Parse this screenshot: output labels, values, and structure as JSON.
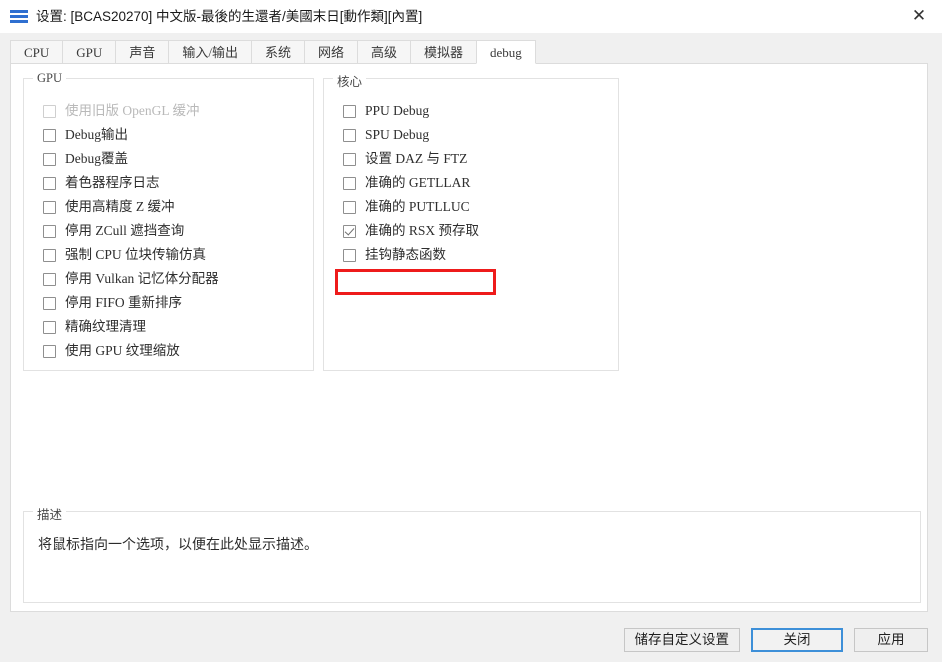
{
  "window": {
    "title": "设置: [BCAS20270] 中文版-最後的生還者/美國末日[動作類][內置]",
    "icon": "settings-lines-icon",
    "close_label": "✕"
  },
  "tabs": [
    {
      "label": "CPU",
      "active": false
    },
    {
      "label": "GPU",
      "active": false
    },
    {
      "label": "声音",
      "active": false
    },
    {
      "label": "输入/输出",
      "active": false
    },
    {
      "label": "系统",
      "active": false
    },
    {
      "label": "网络",
      "active": false
    },
    {
      "label": "高级",
      "active": false
    },
    {
      "label": "模拟器",
      "active": false
    },
    {
      "label": "debug",
      "active": true
    }
  ],
  "gpu_group": {
    "legend": "GPU",
    "items": [
      {
        "label": "使用旧版 OpenGL 缓冲",
        "checked": false,
        "disabled": true
      },
      {
        "label": "Debug输出",
        "checked": false,
        "disabled": false
      },
      {
        "label": "Debug覆盖",
        "checked": false,
        "disabled": false
      },
      {
        "label": "着色器程序日志",
        "checked": false,
        "disabled": false
      },
      {
        "label": "使用高精度 Z 缓冲",
        "checked": false,
        "disabled": false
      },
      {
        "label": "停用 ZCull 遮挡查询",
        "checked": false,
        "disabled": false
      },
      {
        "label": "强制 CPU 位块传输仿真",
        "checked": false,
        "disabled": false
      },
      {
        "label": "停用 Vulkan 记忆体分配器",
        "checked": false,
        "disabled": false
      },
      {
        "label": "停用 FIFO 重新排序",
        "checked": false,
        "disabled": false
      },
      {
        "label": "精确纹理清理",
        "checked": false,
        "disabled": false
      },
      {
        "label": "使用 GPU 纹理缩放",
        "checked": false,
        "disabled": false
      }
    ]
  },
  "core_group": {
    "legend": "核心",
    "items": [
      {
        "label": "PPU Debug",
        "checked": false,
        "disabled": false
      },
      {
        "label": "SPU Debug",
        "checked": false,
        "disabled": false
      },
      {
        "label": "设置 DAZ 与 FTZ",
        "checked": false,
        "disabled": false
      },
      {
        "label": "准确的 GETLLAR",
        "checked": false,
        "disabled": false
      },
      {
        "label": "准确的 PUTLLUC",
        "checked": false,
        "disabled": false
      },
      {
        "label": "准确的 RSX 预存取",
        "checked": true,
        "disabled": false,
        "highlighted": true
      },
      {
        "label": "挂钩静态函数",
        "checked": false,
        "disabled": false
      }
    ]
  },
  "description_group": {
    "legend": "描述",
    "text": "将鼠标指向一个选项，以便在此处显示描述。"
  },
  "footer": {
    "save_custom_label": "储存自定义设置",
    "close_label": "关闭",
    "apply_label": "应用"
  },
  "colors": {
    "highlight": "#ee1b1b",
    "accent": "#3d8fd8",
    "titlebar_bg": "#ffffff",
    "window_bg": "#f0f0f0"
  }
}
